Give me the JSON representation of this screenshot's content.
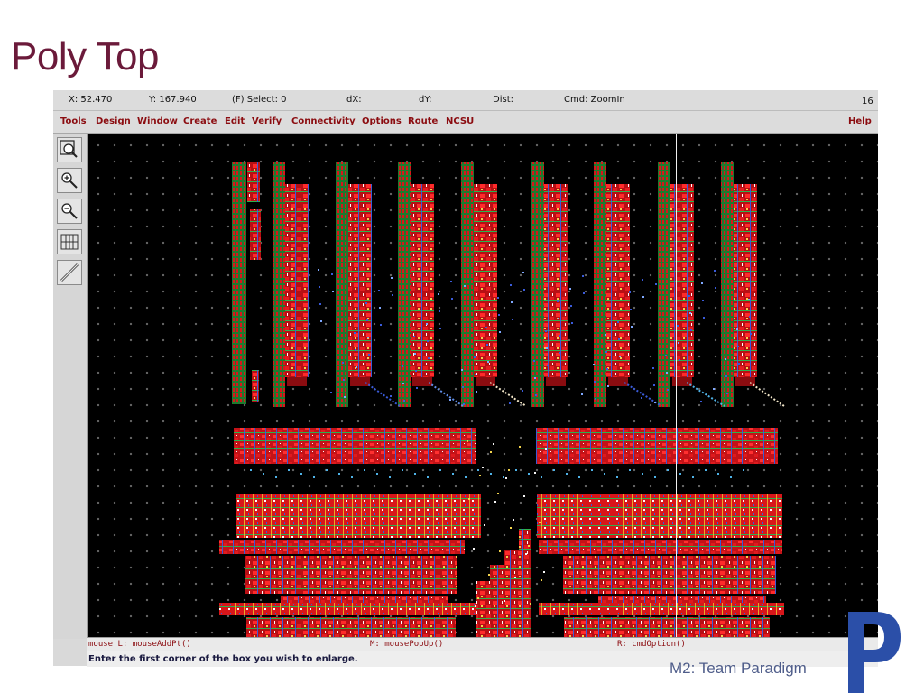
{
  "slide": {
    "title": "Poly Top",
    "footer": "M2: Team Paradigm"
  },
  "coord_bar": {
    "x": "X:  52.470",
    "y": "Y:  167.940",
    "select": "(F) Select: 0",
    "dx": "dX:",
    "dy": "dY:",
    "dist": "Dist:",
    "cmd": "Cmd: ZoomIn",
    "num": "16"
  },
  "menu": {
    "items": [
      "Tools",
      "Design",
      "Window",
      "Create",
      "Edit",
      "Verify",
      "Connectivity",
      "Options",
      "Route",
      "NCSU"
    ],
    "help": "Help"
  },
  "toolbar": {
    "icons": [
      "zoom-fit-icon",
      "zoom-in-icon",
      "zoom-out-icon",
      "stretch-icon",
      "ruler-icon"
    ]
  },
  "mouse_bar": {
    "left": "mouse L: mouseAddPt()",
    "middle": "M: mousePopUp()",
    "right": "R: cmdOption()"
  },
  "prompt": "Enter the first corner of the box you wish to enlarge.",
  "colors": {
    "title": "#6b1a3a",
    "menu_text": "#8b0c10",
    "canvas_bg": "#000000",
    "layout_red": "#d8161a",
    "layout_green": "#2bb24c",
    "layout_blue": "#3a5bd9",
    "footer_text": "#4f5d8a"
  }
}
